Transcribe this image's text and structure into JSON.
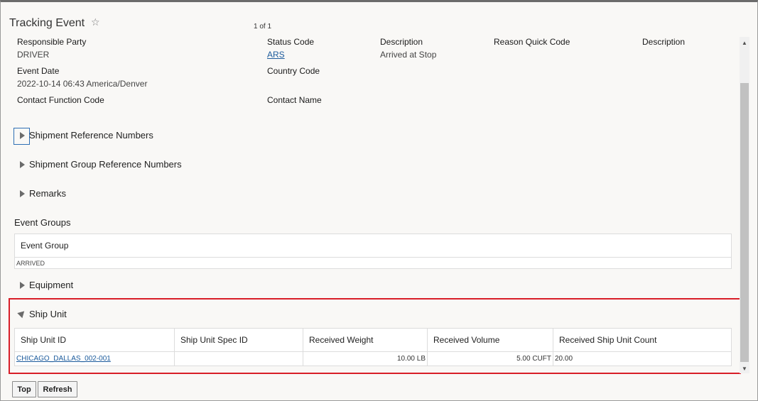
{
  "page": {
    "title": "Tracking Event",
    "favorite_glyph": "☆",
    "pager": "1 of 1"
  },
  "fields": {
    "responsible_party": {
      "label": "Responsible Party",
      "value": "DRIVER"
    },
    "event_date": {
      "label": "Event Date",
      "value": "2022-10-14 06:43 America/Denver"
    },
    "contact_function_code": {
      "label": "Contact Function Code",
      "value": ""
    },
    "status_code": {
      "label": "Status Code",
      "value": "ARS"
    },
    "country_code": {
      "label": "Country Code",
      "value": ""
    },
    "contact_name": {
      "label": "Contact Name",
      "value": ""
    },
    "description": {
      "label": "Description",
      "value": "Arrived at Stop"
    },
    "reason_quick_code": {
      "label": "Reason Quick Code",
      "value": ""
    },
    "description2": {
      "label": "Description",
      "value": ""
    }
  },
  "sections": {
    "shipment_reference_numbers": "Shipment Reference Numbers",
    "shipment_group_reference_numbers": "Shipment Group Reference Numbers",
    "remarks": "Remarks",
    "event_groups": "Event Groups",
    "equipment": "Equipment",
    "ship_unit": "Ship Unit"
  },
  "event_groups_table": {
    "headers": [
      "Event Group"
    ],
    "rows": [
      [
        "ARRIVED"
      ]
    ]
  },
  "ship_unit_table": {
    "headers": [
      "Ship Unit ID",
      "Ship Unit Spec ID",
      "Received Weight",
      "Received Volume",
      "Received Ship Unit Count"
    ],
    "rows": [
      [
        "CHICAGO_DALLAS_002-001",
        "",
        "10.00 LB",
        "5.00 CUFT",
        "20.00"
      ]
    ]
  },
  "buttons": {
    "top": "Top",
    "refresh": "Refresh"
  },
  "colors": {
    "link": "#1c5b9c",
    "highlight": "#d81e28",
    "background": "#f9f8f6"
  }
}
